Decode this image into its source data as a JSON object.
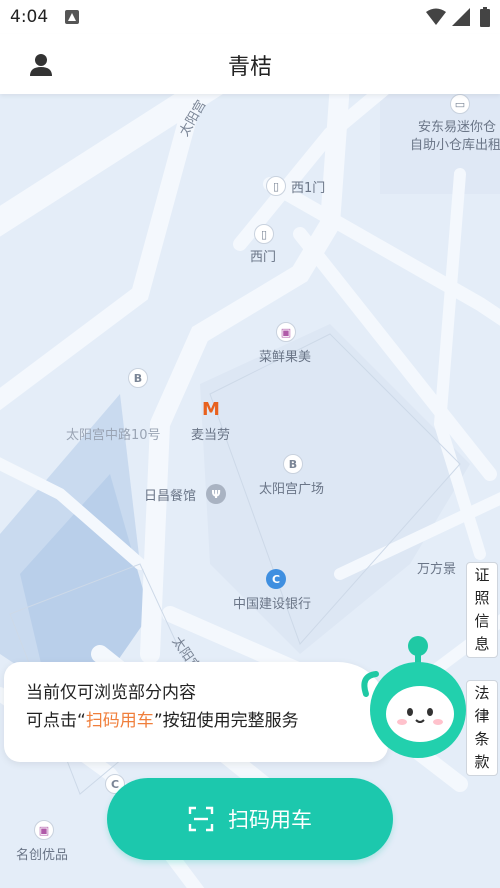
{
  "status_bar": {
    "time": "4:04"
  },
  "header": {
    "title": "青桔",
    "user_icon": "person-icon"
  },
  "map": {
    "road_labels": [
      "太阳宫",
      "太阳宫"
    ],
    "pois": [
      {
        "label": "安东易迷你仓",
        "icon": "box-icon"
      },
      {
        "label": "自助小仓库出租",
        "icon": ""
      },
      {
        "label": "西1门",
        "icon": "gate-icon"
      },
      {
        "label": "西门",
        "icon": "gate-icon"
      },
      {
        "label": "菜鲜果美",
        "icon": "shop-icon"
      },
      {
        "label": "B",
        "icon": "bus-icon"
      },
      {
        "label": "太阳宫中路10号",
        "icon": ""
      },
      {
        "label": "麦当劳",
        "icon": "mcdonalds-icon"
      },
      {
        "label": "太阳宫广场",
        "icon": "bus-icon"
      },
      {
        "label": "日昌餐馆",
        "icon": "restaurant-icon"
      },
      {
        "label": "万方景",
        "icon": ""
      },
      {
        "label": "中国建设银行",
        "icon": "bank-icon"
      },
      {
        "label": "名创优品",
        "icon": "shop-icon"
      },
      {
        "label": "C",
        "icon": "bus-icon"
      }
    ]
  },
  "side_tabs": {
    "certificates": [
      "证",
      "照",
      "信",
      "息"
    ],
    "legal": [
      "法",
      "律",
      "条",
      "款"
    ]
  },
  "notice": {
    "line1": "当前仅可浏览部分内容",
    "line2_prefix": "可点击“",
    "line2_highlight": "扫码用车",
    "line2_suffix": "”按钮使用完整服务"
  },
  "scan_button": {
    "label": "扫码用车",
    "icon": "scan-icon"
  },
  "colors": {
    "accent": "#1cc8ad",
    "highlight": "#f07f3c",
    "map_background": "#e4edf8",
    "road": "#f4f8fd"
  }
}
